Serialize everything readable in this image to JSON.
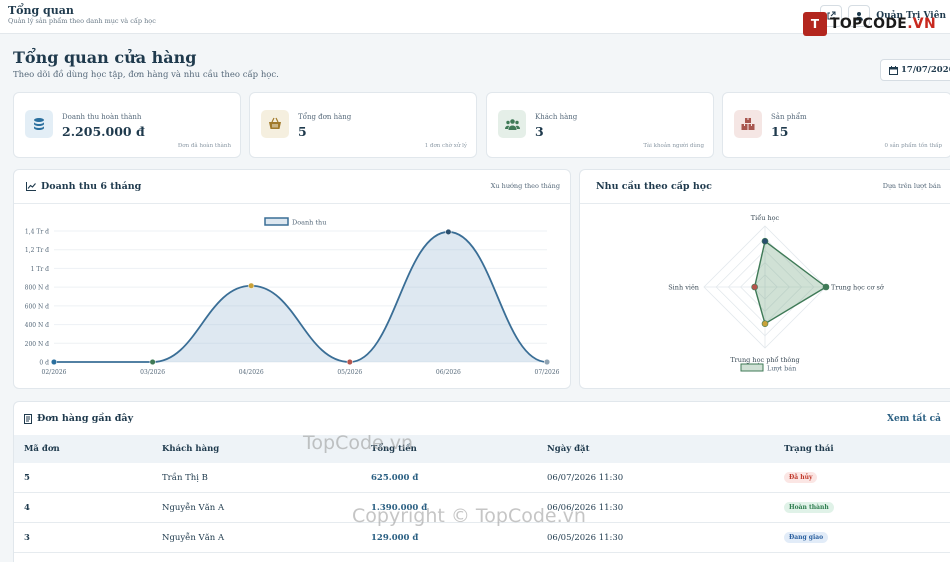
{
  "topbar": {
    "title": "Tổng quan",
    "subtitle": "Quản lý sản phẩm theo danh mục và cấp học",
    "user_name": "Quản Trị Viên"
  },
  "logo": {
    "badge": "T",
    "text_main": "TOPCODE",
    "text_suffix": ".VN"
  },
  "header": {
    "title": "Tổng quan cửa hàng",
    "subtitle": "Theo dõi đồ dùng học tập, đơn hàng và nhu cầu theo cấp học.",
    "date": "17/07/2026"
  },
  "stats": [
    {
      "label": "Doanh thu hoàn thành",
      "value": "2.205.000 đ",
      "note": "Đơn đã hoàn thành",
      "icon": "coins-icon",
      "color": "#2a6f9e",
      "bg": "#e3eef6"
    },
    {
      "label": "Tổng đơn hàng",
      "value": "5",
      "note": "1 đơn chờ xử lý",
      "icon": "basket-icon",
      "color": "#a0792a",
      "bg": "#f5efdf"
    },
    {
      "label": "Khách hàng",
      "value": "3",
      "note": "Tài khoản người dùng",
      "icon": "users-icon",
      "color": "#3f7a57",
      "bg": "#e5efe8"
    },
    {
      "label": "Sản phẩm",
      "value": "15",
      "note": "0 sản phẩm tồn thấp",
      "icon": "boxes-icon",
      "color": "#a8564f",
      "bg": "#f5e6e4"
    }
  ],
  "revenue_panel": {
    "title": "Doanh thu 6 tháng",
    "link": "Xu hướng theo tháng",
    "legend": "Doanh thu"
  },
  "demand_panel": {
    "title": "Nhu cầu theo cấp học",
    "link": "Dựa trên lượt bán",
    "legend": "Lượt bán"
  },
  "orders": {
    "title": "Đơn hàng gần đây",
    "view_all": "Xem tất cả",
    "columns": [
      "Mã đơn",
      "Khách hàng",
      "Tổng tiền",
      "Ngày đặt",
      "Trạng thái"
    ],
    "rows": [
      {
        "id": "5",
        "customer": "Trần Thị B",
        "total": "625.000 đ",
        "date": "06/07/2026 11:30",
        "status": "Đã hủy",
        "status_color": "#c0392b",
        "status_bg": "#fbe6e4"
      },
      {
        "id": "4",
        "customer": "Nguyễn Văn A",
        "total": "1.390.000 đ",
        "date": "06/06/2026 11:30",
        "status": "Hoàn thành",
        "status_color": "#2e7d4f",
        "status_bg": "#e0f2e8"
      },
      {
        "id": "3",
        "customer": "Nguyễn Văn A",
        "total": "129.000 đ",
        "date": "06/05/2026 11:30",
        "status": "Đang giao",
        "status_color": "#2a5f9e",
        "status_bg": "#e2ecf8"
      }
    ]
  },
  "watermarks": {
    "mid": "TopCode.vn",
    "bottom": "Copyright © TopCode.vn"
  },
  "chart_data": [
    {
      "type": "area",
      "title": "Doanh thu 6 tháng",
      "categories": [
        "02/2026",
        "03/2026",
        "04/2026",
        "05/2026",
        "06/2026",
        "07/2026"
      ],
      "series": [
        {
          "name": "Doanh thu",
          "values": [
            0,
            0,
            815000,
            0,
            1390000,
            0
          ]
        }
      ],
      "point_colors": [
        "#2a6f9e",
        "#3f7a57",
        "#c9a23a",
        "#b5544c",
        "#2a4f6e",
        "#8fa3b3"
      ],
      "y_ticks": [
        "0 đ",
        "200 N đ",
        "400 N đ",
        "600 N đ",
        "800 N đ",
        "1 Tr đ",
        "1,2 Tr đ",
        "1,4 Tr đ"
      ],
      "ylim": [
        0,
        1400000
      ],
      "grid": true,
      "legend": "top"
    },
    {
      "type": "radar",
      "title": "Nhu cầu theo cấp học",
      "categories": [
        "Tiểu học",
        "Trung học cơ sở",
        "Trung học phổ thông",
        "Sinh viên"
      ],
      "series": [
        {
          "name": "Lượt bán",
          "values": [
            0.7,
            1.0,
            0.52,
            0.0
          ]
        }
      ],
      "point_colors": [
        "#2a4f6e",
        "#3f7a57",
        "#c9a23a",
        "#b5544c"
      ],
      "legend": "bottom"
    }
  ]
}
